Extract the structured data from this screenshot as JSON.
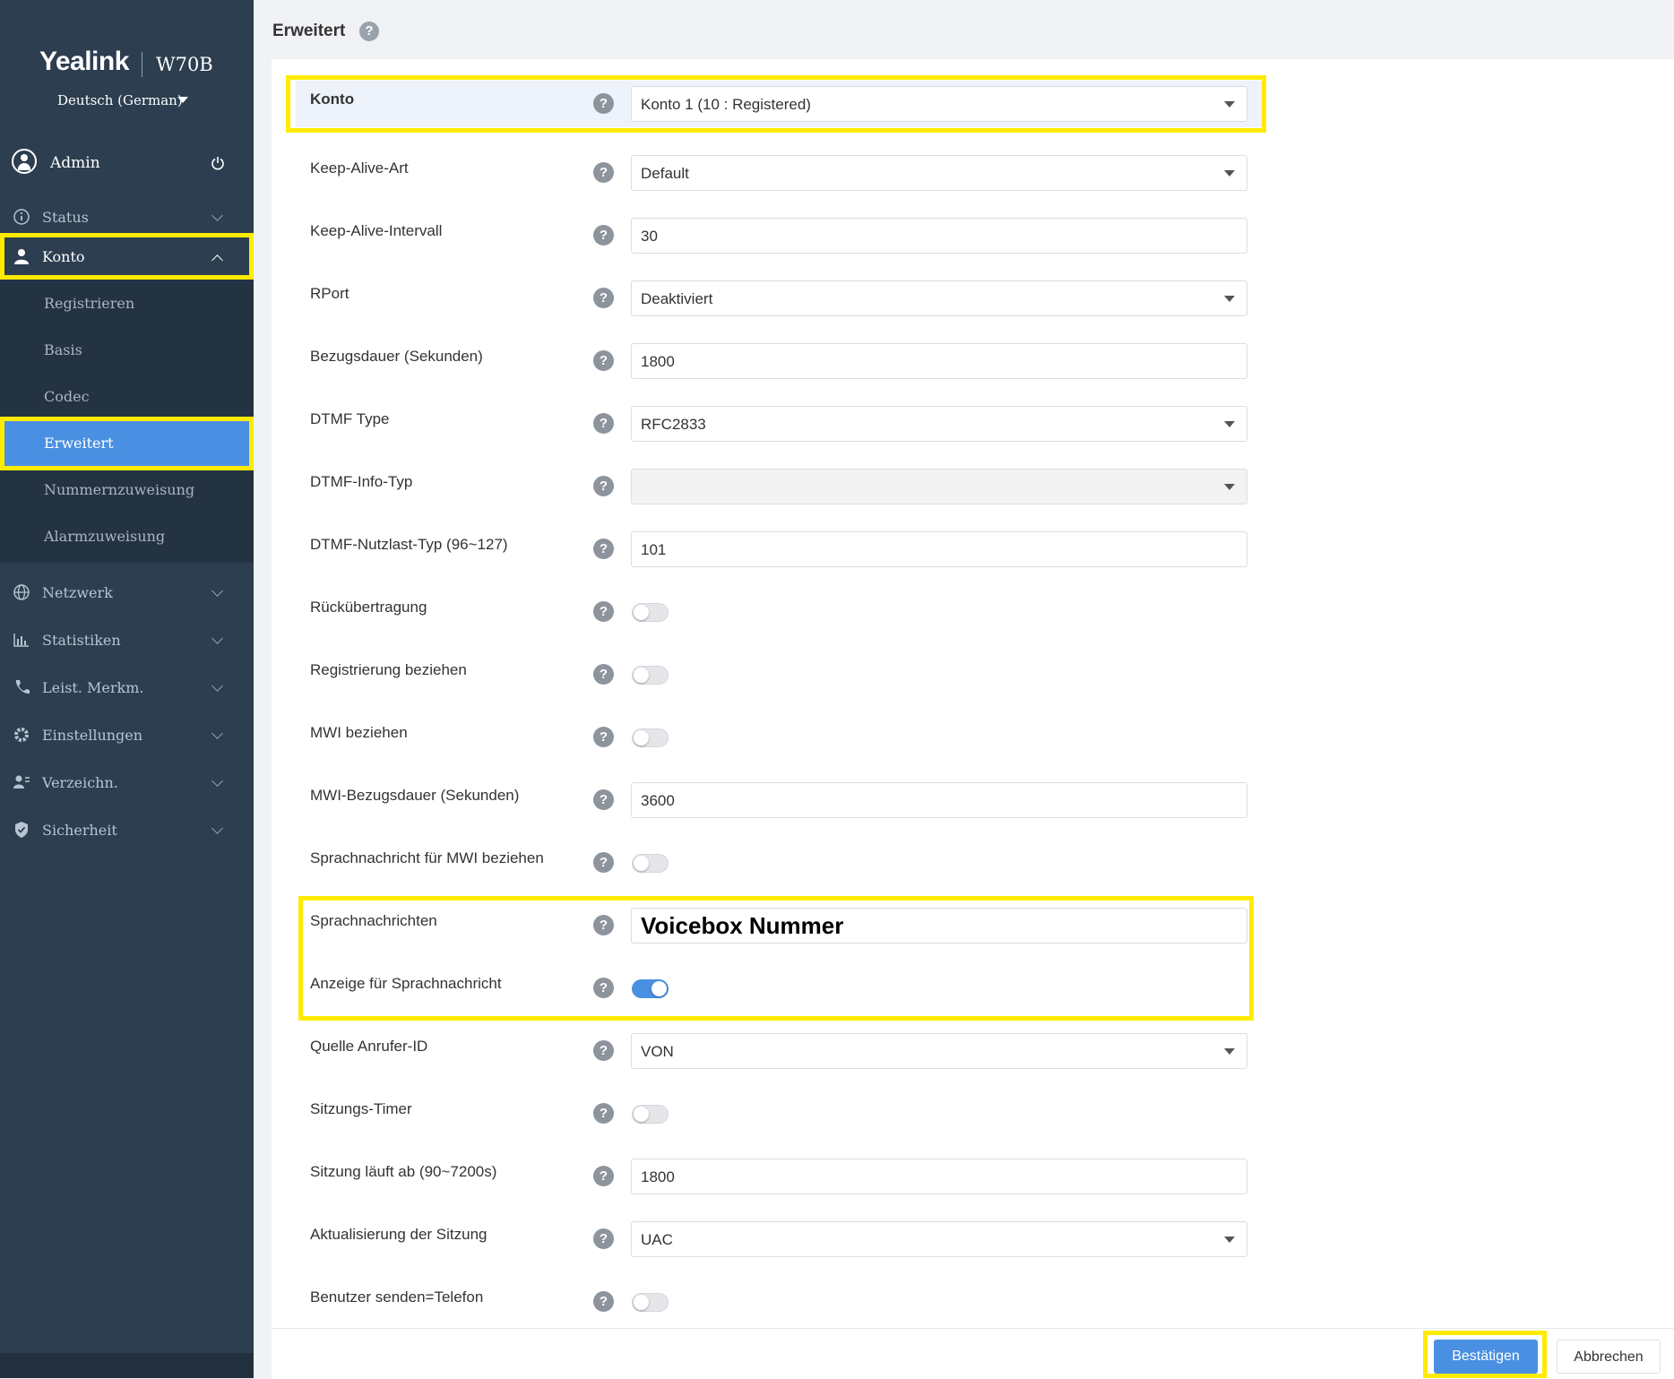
{
  "sidebar": {
    "brand": "Yealink",
    "model": "W70B",
    "language": "Deutsch (German)",
    "user": "Admin",
    "nav": [
      {
        "label": "Status",
        "icon": "info-icon"
      },
      {
        "label": "Konto",
        "icon": "user-icon",
        "expanded": true
      },
      {
        "label": "Netzwerk",
        "icon": "globe-icon"
      },
      {
        "label": "Statistiken",
        "icon": "bar-chart-icon"
      },
      {
        "label": "Leist. Merkm.",
        "icon": "phone-icon"
      },
      {
        "label": "Einstellungen",
        "icon": "gear-icon"
      },
      {
        "label": "Verzeichn.",
        "icon": "contacts-icon"
      },
      {
        "label": "Sicherheit",
        "icon": "shield-icon"
      }
    ],
    "submenu": [
      "Registrieren",
      "Basis",
      "Codec",
      "Erweitert",
      "Nummernzuweisung",
      "Alarmzuweisung"
    ],
    "active_submenu": "Erweitert"
  },
  "page": {
    "title": "Erweitert",
    "help": "?"
  },
  "form": {
    "konto": {
      "label": "Konto",
      "value": "Konto 1 (10 : Registered)"
    },
    "keep_alive_art": {
      "label": "Keep-Alive-Art",
      "value": "Default"
    },
    "keep_alive_intervall": {
      "label": "Keep-Alive-Intervall",
      "value": "30"
    },
    "rport": {
      "label": "RPort",
      "value": "Deaktiviert"
    },
    "bezugsdauer": {
      "label": "Bezugsdauer (Sekunden)",
      "value": "1800"
    },
    "dtmf_type": {
      "label": "DTMF Type",
      "value": "RFC2833"
    },
    "dtmf_info_typ": {
      "label": "DTMF-Info-Typ",
      "value": ""
    },
    "dtmf_nutzlast": {
      "label": "DTMF-Nutzlast-Typ (96~127)",
      "value": "101"
    },
    "rueckuebertragung": {
      "label": "Rückübertragung",
      "on": false
    },
    "registrierung_beziehen": {
      "label": "Registrierung beziehen",
      "on": false
    },
    "mwi_beziehen": {
      "label": "MWI beziehen",
      "on": false
    },
    "mwi_bezugsdauer": {
      "label": "MWI-Bezugsdauer (Sekunden)",
      "value": "3600"
    },
    "sprachnachricht_mwi": {
      "label": "Sprachnachricht für MWI beziehen",
      "on": false
    },
    "sprachnachrichten": {
      "label": "Sprachnachrichten",
      "value": "Voicebox Nummer"
    },
    "anzeige_sprachnachricht": {
      "label": "Anzeige für Sprachnachricht",
      "on": true
    },
    "quelle_anrufer_id": {
      "label": "Quelle Anrufer-ID",
      "value": "VON"
    },
    "sitzungs_timer": {
      "label": "Sitzungs-Timer",
      "on": false
    },
    "sitzung_laeuft_ab": {
      "label": "Sitzung läuft ab (90~7200s)",
      "value": "1800"
    },
    "aktualisierung_sitzung": {
      "label": "Aktualisierung der Sitzung",
      "value": "UAC"
    },
    "benutzer_senden": {
      "label": "Benutzer senden=Telefon",
      "on": false
    }
  },
  "footer": {
    "confirm": "Bestätigen",
    "cancel": "Abbrechen"
  },
  "colors": {
    "sidebar_bg": "#2c3e50",
    "accent": "#4a90e2",
    "highlight": "#ffeb00"
  }
}
